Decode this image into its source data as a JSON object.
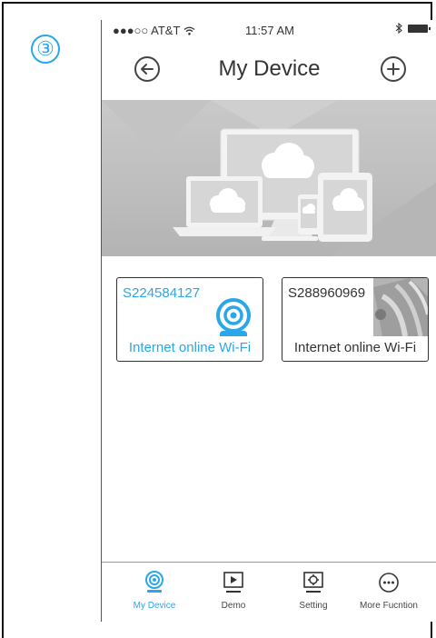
{
  "step_badge": "③",
  "status_bar": {
    "carrier": "●●●○○ AT&T",
    "time": "11:57 AM"
  },
  "nav": {
    "title": "My Device",
    "back_icon": "back-arrow-circle-icon",
    "add_icon": "plus-circle-icon"
  },
  "banner": {
    "icon": "cloud-devices-illustration"
  },
  "devices": [
    {
      "id": "S224584127",
      "status": "Internet online Wi-Fi",
      "selected": true,
      "thumbnail": "camera-icon"
    },
    {
      "id": "S288960969",
      "status": "Internet online Wi-Fi",
      "selected": false,
      "thumbnail": "camera-snapshot"
    }
  ],
  "tabbar": {
    "tabs": [
      {
        "label": "My Device",
        "icon": "camera-icon",
        "active": true
      },
      {
        "label": "Demo",
        "icon": "play-icon",
        "active": false
      },
      {
        "label": "Setting",
        "icon": "gear-icon",
        "active": false
      },
      {
        "label": "More Fucntion",
        "icon": "more-icon",
        "active": false
      }
    ]
  },
  "colors": {
    "accent": "#2aa7e8",
    "text": "#333333",
    "banner": "#bdbdbd"
  }
}
